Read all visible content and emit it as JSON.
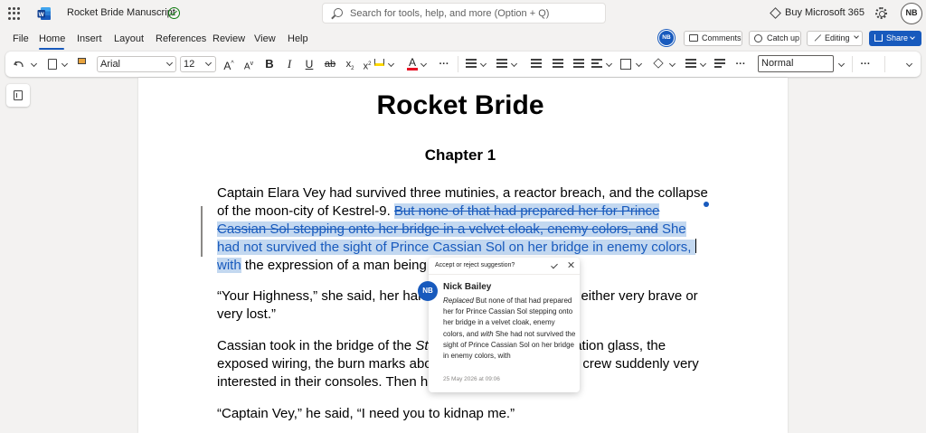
{
  "titlebar": {
    "doc_title": "Rocket Bride Manuscript",
    "search_placeholder": "Search for tools, help, and more (Option + Q)",
    "buy_label": "Buy Microsoft 365",
    "user_initials": "NB"
  },
  "menu": {
    "items": [
      "File",
      "Home",
      "Insert",
      "Layout",
      "References",
      "Review",
      "View",
      "Help"
    ],
    "active": "Home",
    "comments_label": "Comments",
    "catchup_label": "Catch up",
    "editing_label": "Editing",
    "share_label": "Share"
  },
  "ribbon": {
    "font_name": "Arial",
    "font_size": "12",
    "style_name": "Normal"
  },
  "document": {
    "title": "Rocket Bride",
    "chapter": "Chapter 1",
    "p1_start": "Captain Elara Vey had survived three mutinies, a reactor breach, and the collapse of the moon-city of Kestrel-9. ",
    "p1_deleted": "But none of that had prepared her for Prince Cassian Sol stepping onto her bridge in a velvet cloak, enemy colors, and",
    "p1_inserted": " She had not survived the sight of Prince Cassian Sol on her bridge in enemy colors, ",
    "p1_with": "with",
    "p1_end": " the expression of a man being chased by fate.",
    "p2": "“Your Highness,” she said, her hand on her sidearm. “You’re either very brave or very lost.”",
    "p3_start": "Cassian took in the bridge of the ",
    "p3_italic": "Starfall",
    "p3_end": ", its cracked observation glass, the exposed wiring, the burn marks above the consoles, and the crew suddenly very interested in their consoles. Then his gaze settled on her.",
    "p4": "“Captain Vey,” he said, “I need you to kidnap me.”"
  },
  "suggestion": {
    "prompt": "Accept or reject suggestion?",
    "author": "Nick Bailey",
    "author_initials": "NB",
    "replaced_label": "Replaced",
    "replaced_text": " But none of that had prepared her for Prince Cassian Sol stepping onto her bridge in a velvet cloak, enemy colors, and ",
    "with_label": "with",
    "with_text": " She had not survived the sight of Prince Cassian Sol on her bridge in enemy colors, with",
    "timestamp": "25 May 2026 at 09:06"
  },
  "colors": {
    "accent": "#185abd",
    "highlight": "#c3d8f0"
  }
}
